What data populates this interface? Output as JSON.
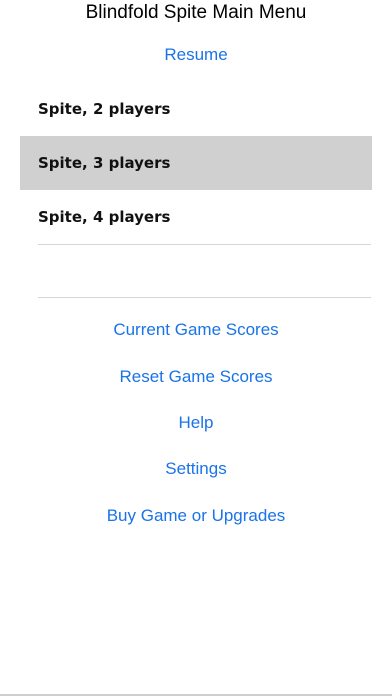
{
  "header": {
    "title": "Blindfold Spite Main Menu"
  },
  "actions": {
    "resume": "Resume"
  },
  "games": {
    "items": [
      {
        "label": "Spite, 2 players",
        "selected": false
      },
      {
        "label": "Spite, 3 players",
        "selected": true
      },
      {
        "label": "Spite, 4 players",
        "selected": false
      }
    ]
  },
  "links": {
    "current_scores": "Current Game Scores",
    "reset_scores": "Reset Game Scores",
    "help": "Help",
    "settings": "Settings",
    "buy": "Buy Game or Upgrades"
  },
  "colors": {
    "link": "#1a73e8",
    "selected_bg": "#d0d0d0"
  }
}
